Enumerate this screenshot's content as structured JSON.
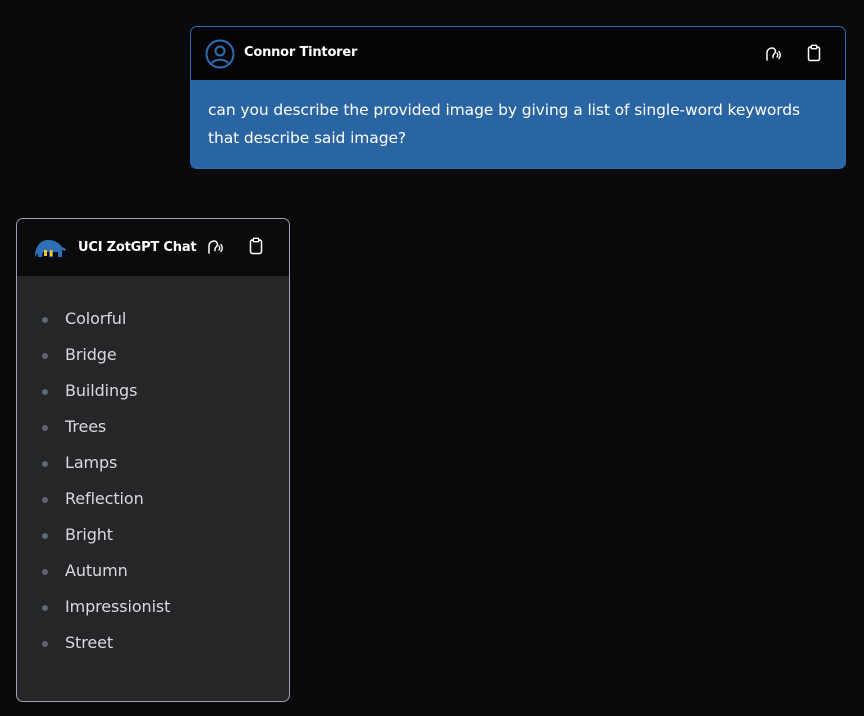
{
  "user_message": {
    "author": "Connor Tintorer",
    "text": "can you describe the provided image by giving a list of single-word keywords that describe said image?",
    "icons": {
      "avatar": "user-avatar-icon",
      "read_aloud": "speaker-icon",
      "copy": "clipboard-icon"
    },
    "colors": {
      "body_bg": "#2a65a3",
      "border": "#2b6cb0",
      "header_bg": "#050507"
    }
  },
  "bot_message": {
    "author": "UCI ZotGPT Chat",
    "keywords": [
      "Colorful",
      "Bridge",
      "Buildings",
      "Trees",
      "Lamps",
      "Reflection",
      "Bright",
      "Autumn",
      "Impressionist",
      "Street"
    ],
    "icons": {
      "logo": "anteater-logo-icon",
      "read_aloud": "speaker-icon",
      "copy": "clipboard-icon"
    },
    "colors": {
      "body_bg": "#262629",
      "border": "#9aa3b2",
      "header_bg": "#0b0b0d"
    }
  },
  "colors": {
    "page_bg": "#0a0a0c"
  }
}
